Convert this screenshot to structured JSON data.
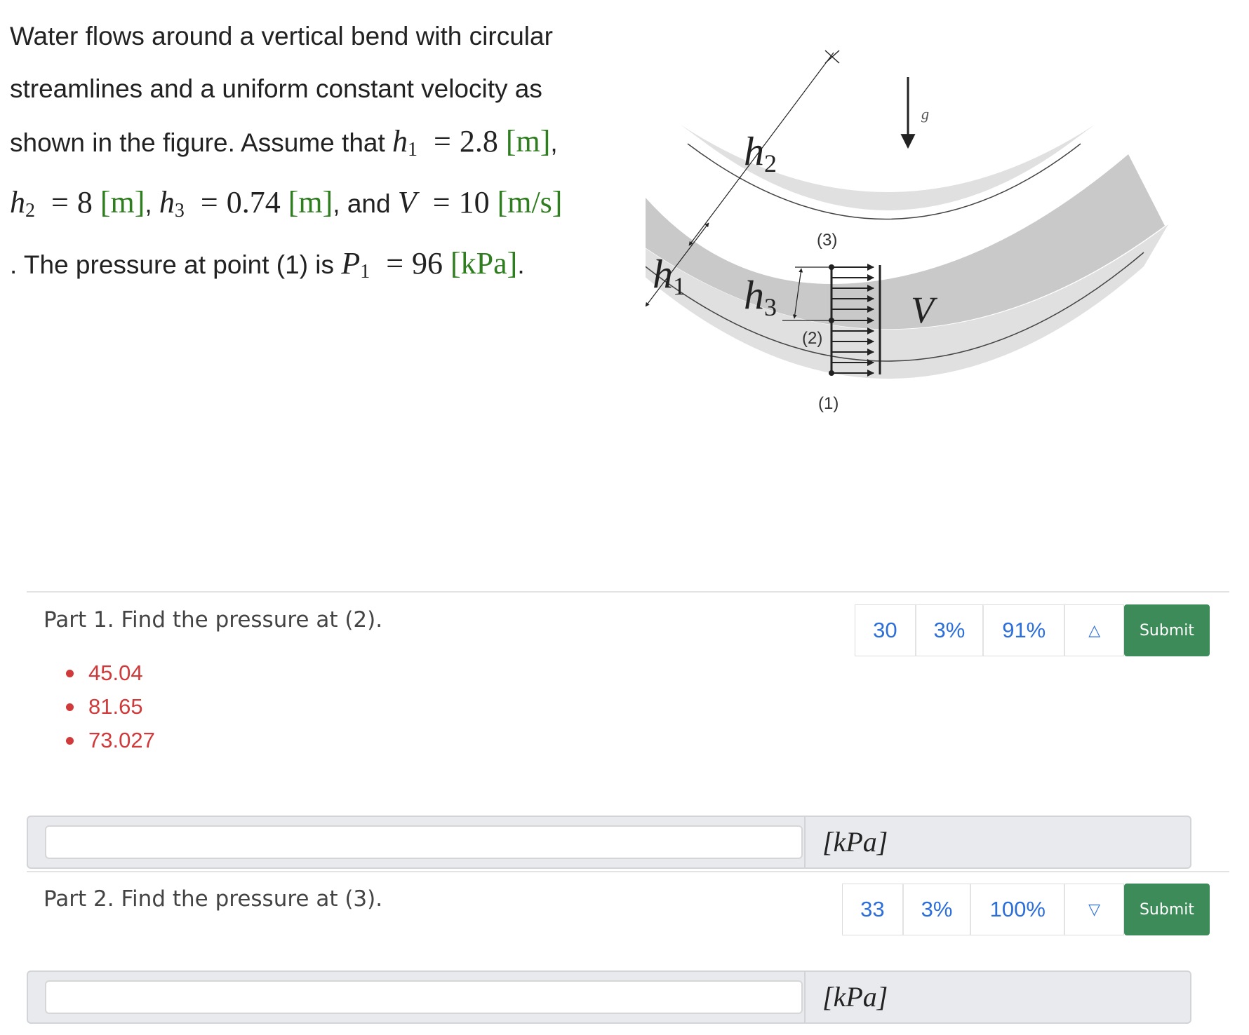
{
  "problem": {
    "line1": "Water flows around a vertical bend with circular",
    "line2": "streamlines and a uniform constant velocity as",
    "line3_text": "shown in the figure. Assume that ",
    "h1_sym": "h",
    "h1_sub": "1",
    "eq": "=",
    "h1_val": "2.8",
    "h2_sym": "h",
    "h2_sub": "2",
    "h2_val": "8",
    "h3_sym": "h",
    "h3_sub": "3",
    "h3_val": "0.74",
    "and_text": "and",
    "v_sym": "V",
    "v_val": "10",
    "line5_text": ". The pressure at point (1) is ",
    "p1_sym": "P",
    "p1_sub": "1",
    "p1_val": "96",
    "unit_m": "[m]",
    "unit_ms": "[m/s]",
    "unit_kpa": "[kPa]",
    "comma": ",",
    "period": "."
  },
  "figure": {
    "h1": "h",
    "h1_sub": "1",
    "h2": "h",
    "h2_sub": "2",
    "h3": "h",
    "h3_sub": "3",
    "v": "V",
    "g": "g",
    "point1": "(1)",
    "point2": "(2)",
    "point3": "(3)"
  },
  "parts": [
    {
      "title": "Part 1. Find the pressure at (2).",
      "previous_answers": [
        "45.04",
        "81.65",
        "73.027"
      ],
      "stats": {
        "attempts": "30",
        "pct_a": "3%",
        "pct_b": "91%"
      },
      "toggle_icon": "triangle-up-icon",
      "submit_label": "Submit",
      "answer_value": "",
      "unit": "[kPa]"
    },
    {
      "title": "Part 2. Find the pressure at (3).",
      "previous_answers": [],
      "stats": {
        "attempts": "33",
        "pct_a": "3%",
        "pct_b": "100%"
      },
      "toggle_icon": "triangle-down-icon",
      "submit_label": "Submit",
      "answer_value": "",
      "unit": "[kPa]"
    }
  ],
  "colors": {
    "unit_green": "#2e7d1e",
    "answer_red": "#d03a3a",
    "stat_blue": "#2c6fdb",
    "submit_green": "#3c8b58"
  }
}
